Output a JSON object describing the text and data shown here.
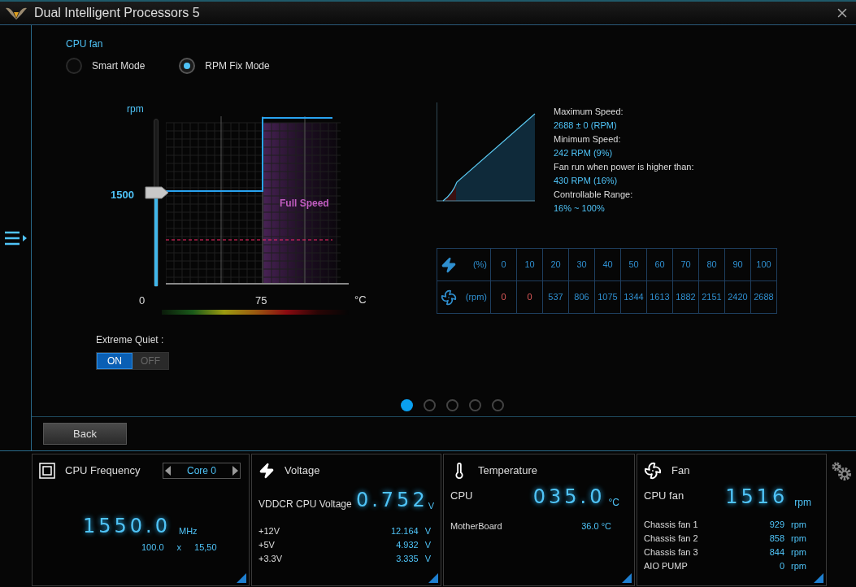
{
  "window": {
    "title": "Dual Intelligent Processors 5"
  },
  "fan": {
    "name": "CPU fan",
    "modes": [
      {
        "label": "Smart Mode",
        "selected": false
      },
      {
        "label": "RPM Fix Mode",
        "selected": true
      }
    ],
    "curve": {
      "y_unit": "rpm",
      "slider": {
        "level": 0.56,
        "reading": "1500"
      },
      "zone_label": "Full Speed",
      "x_ticks": [
        "0",
        "75"
      ],
      "x_unit": "°C"
    },
    "extreme_quiet": {
      "label": "Extreme Quiet :",
      "options": [
        {
          "label": "ON",
          "selected": true
        },
        {
          "label": "OFF",
          "selected": false
        }
      ]
    }
  },
  "speed_info": [
    {
      "label": "Maximum Speed:",
      "value": "2688 ± 0 (RPM)"
    },
    {
      "label": "Minimum Speed:",
      "value": "242 RPM (9%)"
    },
    {
      "label": "Fan run when power is higher than:",
      "value": "430 RPM (16%)"
    },
    {
      "label": "Controllable Range:",
      "value": "16% ~ 100%"
    }
  ],
  "speed_table": {
    "power_unit": "(%)",
    "rpm_unit": "(rpm)",
    "power": [
      "0",
      "10",
      "20",
      "30",
      "40",
      "50",
      "60",
      "70",
      "80",
      "90",
      "100"
    ],
    "rpm": [
      {
        "text": "0",
        "stopped": true
      },
      {
        "text": "0",
        "stopped": true
      },
      {
        "text": "537",
        "stopped": false
      },
      {
        "text": "806",
        "stopped": false
      },
      {
        "text": "1075",
        "stopped": false
      },
      {
        "text": "1344",
        "stopped": false
      },
      {
        "text": "1613",
        "stopped": false
      },
      {
        "text": "1882",
        "stopped": false
      },
      {
        "text": "2151",
        "stopped": false
      },
      {
        "text": "2420",
        "stopped": false
      },
      {
        "text": "2688",
        "stopped": false
      }
    ]
  },
  "pages": [
    {
      "selected": true
    },
    {
      "selected": false
    },
    {
      "selected": false
    },
    {
      "selected": false
    },
    {
      "selected": false
    }
  ],
  "back_button": "Back",
  "monitors": {
    "cpu_frequency": {
      "title": "CPU Frequency",
      "core": "Core 0",
      "value": "1550.0",
      "unit": "MHz",
      "bclk": "100.0",
      "times": "x",
      "ratio": "15,50"
    },
    "voltage": {
      "title": "Voltage",
      "main_label": "VDDCR CPU Voltage",
      "main_value": "0.752",
      "main_unit": "V",
      "rows": [
        {
          "label": "+12V",
          "value": "12.164",
          "unit": "V"
        },
        {
          "label": "+5V",
          "value": "4.932",
          "unit": "V"
        },
        {
          "label": "+3.3V",
          "value": "3.335",
          "unit": "V"
        }
      ]
    },
    "temperature": {
      "title": "Temperature",
      "main_label": "CPU",
      "main_value": "035.0",
      "main_unit": "°C",
      "rows": [
        {
          "label": "MotherBoard",
          "value": "36.0 °C"
        }
      ]
    },
    "fan": {
      "title": "Fan",
      "main_label": "CPU fan",
      "main_value": "1516",
      "main_unit": "rpm",
      "rows": [
        {
          "label": "Chassis fan 1",
          "value": "929",
          "unit": "rpm"
        },
        {
          "label": "Chassis fan 2",
          "value": "858",
          "unit": "rpm"
        },
        {
          "label": "Chassis fan 3",
          "value": "844",
          "unit": "rpm"
        },
        {
          "label": "AIO PUMP",
          "value": "0",
          "unit": "rpm"
        }
      ]
    }
  }
}
